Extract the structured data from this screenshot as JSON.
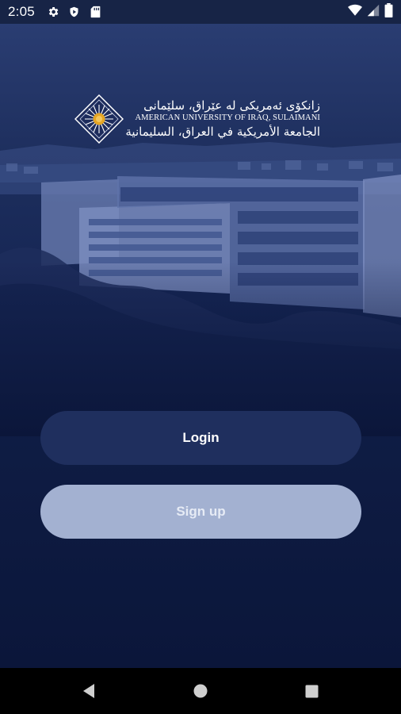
{
  "status_bar": {
    "time": "2:05",
    "icons_left": [
      "settings-icon",
      "shield-icon",
      "sd-card-icon"
    ],
    "icons_right": [
      "wifi-icon",
      "cell-signal-icon",
      "battery-icon"
    ]
  },
  "logo": {
    "kurdish": "زانكۆی ئەمریكی لە عێراق، سلێمانی",
    "english": "AMERICAN UNIVERSITY OF IRAQ, SULAIMANI",
    "arabic": "الجامعة الأمريكية في العراق، السليمانية"
  },
  "actions": {
    "login_label": "Login",
    "signup_label": "Sign up"
  },
  "nav": {
    "icons": [
      "back-icon",
      "home-icon",
      "recents-icon"
    ]
  },
  "colors": {
    "background_top": "#2a3d72",
    "background_bottom": "#0b163a",
    "login_button": "#1f2f5e",
    "signup_button": "#a3b1d1"
  }
}
